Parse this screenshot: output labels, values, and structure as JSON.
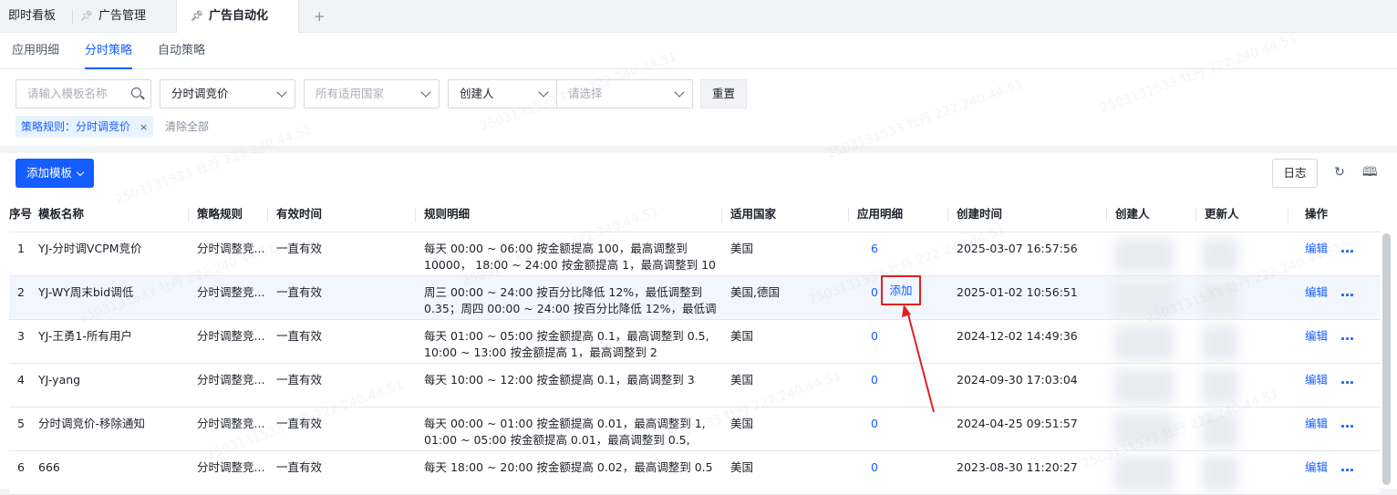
{
  "window_tabs": [
    {
      "label": "即时看板"
    },
    {
      "label": "广告管理"
    },
    {
      "label": "广告自动化"
    }
  ],
  "add_tab": "+",
  "sub_tabs": [
    {
      "label": "应用明细"
    },
    {
      "label": "分时策略"
    },
    {
      "label": "自动策略"
    }
  ],
  "filters": {
    "search_placeholder": "请输入模板名称",
    "strategy_value": "分时调竞价",
    "country_placeholder": "所有适用国家",
    "creator_label": "创建人",
    "creator_placeholder": "请选择",
    "reset": "重置"
  },
  "chip": {
    "label": "策略规则：分时调竞价",
    "close": "×"
  },
  "clear_all": "清除全部",
  "toolbar": {
    "add": "添加模板",
    "log": "日志"
  },
  "columns": [
    "序号",
    "模板名称",
    "策略规则",
    "有效时间",
    "规则明细",
    "适用国家",
    "应用明细",
    "创建时间",
    "创建人",
    "更新人",
    "操作"
  ],
  "rows": [
    {
      "idx": "1",
      "name": "YJ-分时调VCPM竞价",
      "rule": "分时调整竞...",
      "valid": "一直有效",
      "detail": "每天 00:00 ~ 06:00 按金额提高 100，最高调整到 10000， 18:00 ~ 24:00 按金额提高 1，最高调整到 10",
      "country": "美国",
      "apps": "6",
      "created": "2025-03-07 16:57:56",
      "edit": "编辑"
    },
    {
      "idx": "2",
      "name": "YJ-WY周末bid调低",
      "rule": "分时调整竞...",
      "valid": "一直有效",
      "detail": "周三 00:00 ~ 24:00 按百分比降低 12%，最低调整到 0.35；周四 00:00 ~ 24:00 按百分比降低 12%，最低调",
      "country": "美国,德国",
      "apps": "0",
      "add": "添加",
      "created": "2025-01-02 10:56:51",
      "edit": "编辑"
    },
    {
      "idx": "3",
      "name": "YJ-王勇1-所有用户",
      "rule": "分时调整竞...",
      "valid": "一直有效",
      "detail": "每天 01:00 ~ 05:00 按金额提高 0.1，最高调整到 0.5, 10:00 ~ 13:00 按金额提高 1，最高调整到 2",
      "country": "美国",
      "apps": "0",
      "created": "2024-12-02 14:49:36",
      "edit": "编辑"
    },
    {
      "idx": "4",
      "name": "YJ-yang",
      "rule": "分时调整竞...",
      "valid": "一直有效",
      "detail": "每天 10:00 ~ 12:00 按金额提高 0.1，最高调整到 3",
      "country": "美国",
      "apps": "0",
      "created": "2024-09-30 17:03:04",
      "edit": "编辑"
    },
    {
      "idx": "5",
      "name": "分时调竞价-移除通知",
      "rule": "分时调整竞...",
      "valid": "一直有效",
      "detail": "每天 00:00 ~ 01:00 按金额提高 0.01，最高调整到 1, 01:00 ~ 05:00 按金额提高 0.01，最高调整到 0.5,",
      "country": "美国",
      "apps": "0",
      "created": "2024-04-25 09:51:57",
      "edit": "编辑"
    },
    {
      "idx": "6",
      "name": "666",
      "rule": "分时调整竞...",
      "valid": "一直有效",
      "detail": "每天 18:00 ~ 20:00 按金额提高 0.02，最高调整到 0.5",
      "country": "美国",
      "apps": "0",
      "created": "2023-08-30 11:20:27",
      "edit": "编辑"
    }
  ],
  "more_icon": "…",
  "watermark": "2503131533 牡丹 222.240.44.51",
  "colors": {
    "primary": "#165dff",
    "annotation": "#e02020"
  }
}
